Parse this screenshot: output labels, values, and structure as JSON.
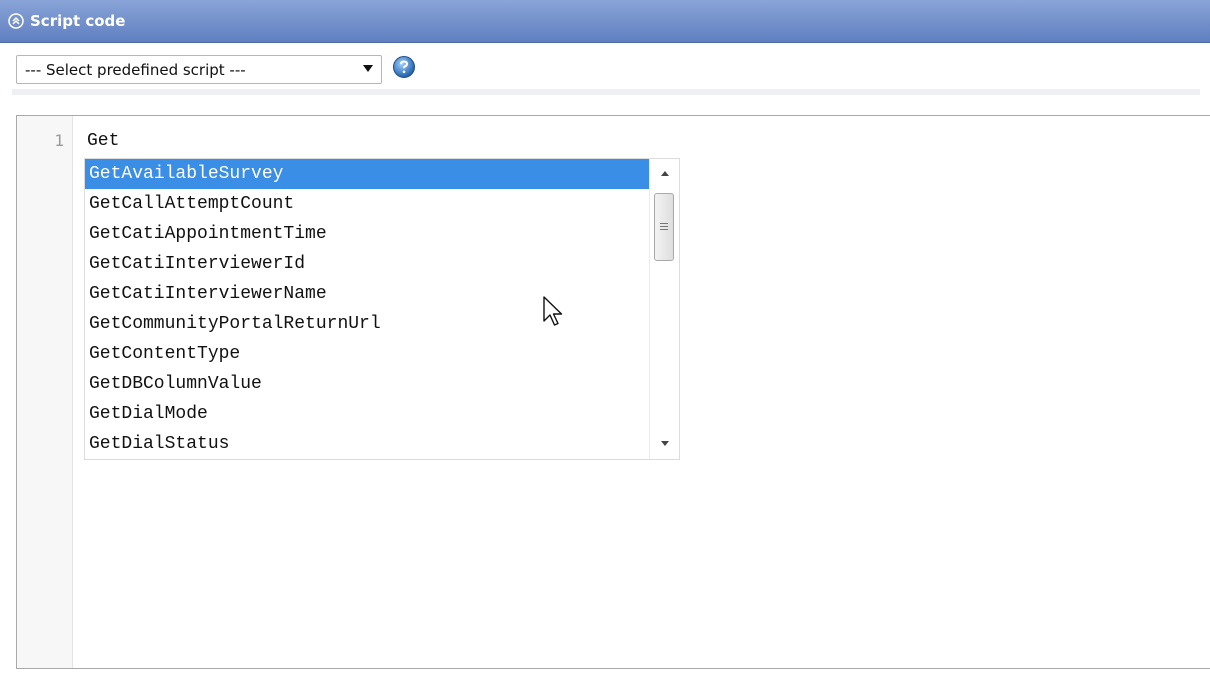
{
  "panel": {
    "title": "Script code",
    "collapse_icon": "double-chevron-up-icon"
  },
  "toolbar": {
    "select_value": "--- Select predefined script ---",
    "help_icon": "help-icon"
  },
  "editor": {
    "line_numbers": [
      "1"
    ],
    "code_lines": [
      "Get"
    ]
  },
  "autocomplete": {
    "selected_index": 0,
    "items": [
      "GetAvailableSurvey",
      "GetCallAttemptCount",
      "GetCatiAppointmentTime",
      "GetCatiInterviewerId",
      "GetCatiInterviewerName",
      "GetCommunityPortalReturnUrl",
      "GetContentType",
      "GetDBColumnValue",
      "GetDialMode",
      "GetDialStatus"
    ]
  },
  "colors": {
    "header": "#6f8dcc",
    "selection": "#3a8ee6"
  }
}
